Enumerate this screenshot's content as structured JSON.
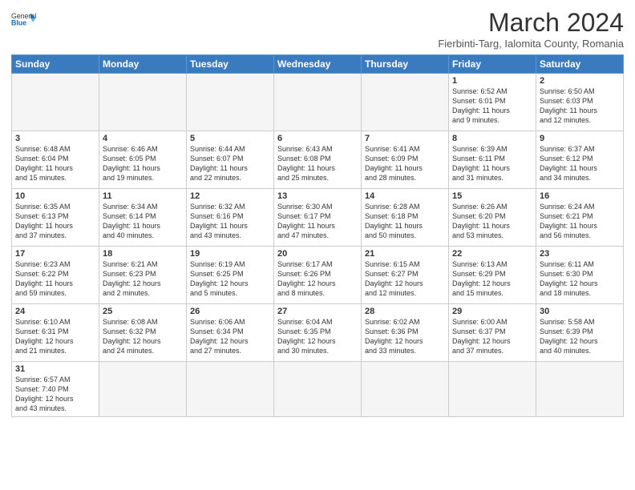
{
  "header": {
    "logo_general": "General",
    "logo_blue": "Blue",
    "month_year": "March 2024",
    "location": "Fierbinti-Targ, Ialomita County, Romania"
  },
  "days_of_week": [
    "Sunday",
    "Monday",
    "Tuesday",
    "Wednesday",
    "Thursday",
    "Friday",
    "Saturday"
  ],
  "weeks": [
    [
      {
        "day": "",
        "info": ""
      },
      {
        "day": "",
        "info": ""
      },
      {
        "day": "",
        "info": ""
      },
      {
        "day": "",
        "info": ""
      },
      {
        "day": "",
        "info": ""
      },
      {
        "day": "1",
        "info": "Sunrise: 6:52 AM\nSunset: 6:01 PM\nDaylight: 11 hours\nand 9 minutes."
      },
      {
        "day": "2",
        "info": "Sunrise: 6:50 AM\nSunset: 6:03 PM\nDaylight: 11 hours\nand 12 minutes."
      }
    ],
    [
      {
        "day": "3",
        "info": "Sunrise: 6:48 AM\nSunset: 6:04 PM\nDaylight: 11 hours\nand 15 minutes."
      },
      {
        "day": "4",
        "info": "Sunrise: 6:46 AM\nSunset: 6:05 PM\nDaylight: 11 hours\nand 19 minutes."
      },
      {
        "day": "5",
        "info": "Sunrise: 6:44 AM\nSunset: 6:07 PM\nDaylight: 11 hours\nand 22 minutes."
      },
      {
        "day": "6",
        "info": "Sunrise: 6:43 AM\nSunset: 6:08 PM\nDaylight: 11 hours\nand 25 minutes."
      },
      {
        "day": "7",
        "info": "Sunrise: 6:41 AM\nSunset: 6:09 PM\nDaylight: 11 hours\nand 28 minutes."
      },
      {
        "day": "8",
        "info": "Sunrise: 6:39 AM\nSunset: 6:11 PM\nDaylight: 11 hours\nand 31 minutes."
      },
      {
        "day": "9",
        "info": "Sunrise: 6:37 AM\nSunset: 6:12 PM\nDaylight: 11 hours\nand 34 minutes."
      }
    ],
    [
      {
        "day": "10",
        "info": "Sunrise: 6:35 AM\nSunset: 6:13 PM\nDaylight: 11 hours\nand 37 minutes."
      },
      {
        "day": "11",
        "info": "Sunrise: 6:34 AM\nSunset: 6:14 PM\nDaylight: 11 hours\nand 40 minutes."
      },
      {
        "day": "12",
        "info": "Sunrise: 6:32 AM\nSunset: 6:16 PM\nDaylight: 11 hours\nand 43 minutes."
      },
      {
        "day": "13",
        "info": "Sunrise: 6:30 AM\nSunset: 6:17 PM\nDaylight: 11 hours\nand 47 minutes."
      },
      {
        "day": "14",
        "info": "Sunrise: 6:28 AM\nSunset: 6:18 PM\nDaylight: 11 hours\nand 50 minutes."
      },
      {
        "day": "15",
        "info": "Sunrise: 6:26 AM\nSunset: 6:20 PM\nDaylight: 11 hours\nand 53 minutes."
      },
      {
        "day": "16",
        "info": "Sunrise: 6:24 AM\nSunset: 6:21 PM\nDaylight: 11 hours\nand 56 minutes."
      }
    ],
    [
      {
        "day": "17",
        "info": "Sunrise: 6:23 AM\nSunset: 6:22 PM\nDaylight: 11 hours\nand 59 minutes."
      },
      {
        "day": "18",
        "info": "Sunrise: 6:21 AM\nSunset: 6:23 PM\nDaylight: 12 hours\nand 2 minutes."
      },
      {
        "day": "19",
        "info": "Sunrise: 6:19 AM\nSunset: 6:25 PM\nDaylight: 12 hours\nand 5 minutes."
      },
      {
        "day": "20",
        "info": "Sunrise: 6:17 AM\nSunset: 6:26 PM\nDaylight: 12 hours\nand 8 minutes."
      },
      {
        "day": "21",
        "info": "Sunrise: 6:15 AM\nSunset: 6:27 PM\nDaylight: 12 hours\nand 12 minutes."
      },
      {
        "day": "22",
        "info": "Sunrise: 6:13 AM\nSunset: 6:29 PM\nDaylight: 12 hours\nand 15 minutes."
      },
      {
        "day": "23",
        "info": "Sunrise: 6:11 AM\nSunset: 6:30 PM\nDaylight: 12 hours\nand 18 minutes."
      }
    ],
    [
      {
        "day": "24",
        "info": "Sunrise: 6:10 AM\nSunset: 6:31 PM\nDaylight: 12 hours\nand 21 minutes."
      },
      {
        "day": "25",
        "info": "Sunrise: 6:08 AM\nSunset: 6:32 PM\nDaylight: 12 hours\nand 24 minutes."
      },
      {
        "day": "26",
        "info": "Sunrise: 6:06 AM\nSunset: 6:34 PM\nDaylight: 12 hours\nand 27 minutes."
      },
      {
        "day": "27",
        "info": "Sunrise: 6:04 AM\nSunset: 6:35 PM\nDaylight: 12 hours\nand 30 minutes."
      },
      {
        "day": "28",
        "info": "Sunrise: 6:02 AM\nSunset: 6:36 PM\nDaylight: 12 hours\nand 33 minutes."
      },
      {
        "day": "29",
        "info": "Sunrise: 6:00 AM\nSunset: 6:37 PM\nDaylight: 12 hours\nand 37 minutes."
      },
      {
        "day": "30",
        "info": "Sunrise: 5:58 AM\nSunset: 6:39 PM\nDaylight: 12 hours\nand 40 minutes."
      }
    ],
    [
      {
        "day": "31",
        "info": "Sunrise: 6:57 AM\nSunset: 7:40 PM\nDaylight: 12 hours\nand 43 minutes."
      },
      {
        "day": "",
        "info": ""
      },
      {
        "day": "",
        "info": ""
      },
      {
        "day": "",
        "info": ""
      },
      {
        "day": "",
        "info": ""
      },
      {
        "day": "",
        "info": ""
      },
      {
        "day": "",
        "info": ""
      }
    ]
  ]
}
